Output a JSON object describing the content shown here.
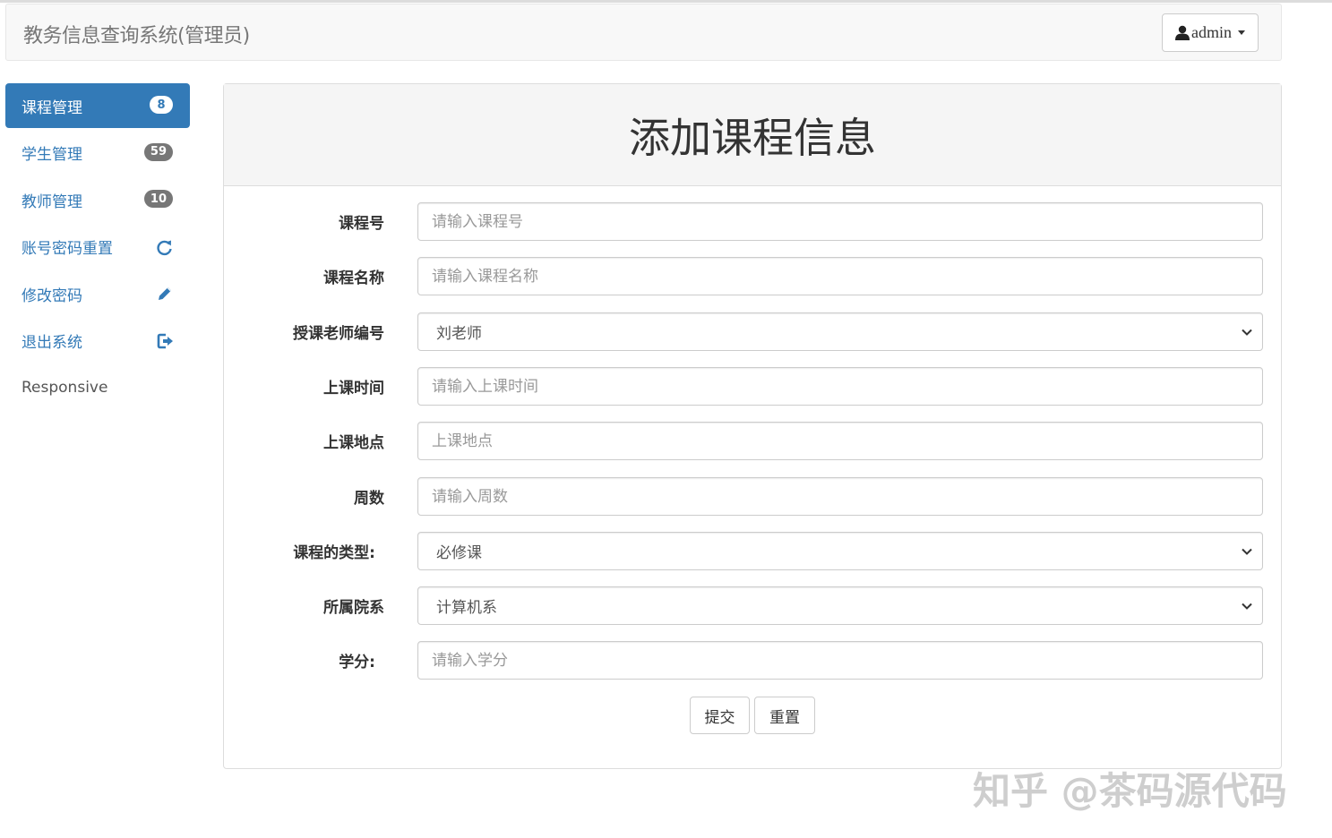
{
  "navbar": {
    "brand": "教务信息查询系统(管理员)",
    "user_label": "admin"
  },
  "sidebar": {
    "items": [
      {
        "label": "课程管理",
        "badge": "8"
      },
      {
        "label": "学生管理",
        "badge": "59"
      },
      {
        "label": "教师管理",
        "badge": "10"
      },
      {
        "label": "账号密码重置",
        "icon": "refresh-icon"
      },
      {
        "label": "修改密码",
        "icon": "pencil-icon"
      },
      {
        "label": "退出系统",
        "icon": "logout-icon"
      },
      {
        "label": "Responsive"
      }
    ]
  },
  "form": {
    "title": "添加课程信息",
    "fields": [
      {
        "label": "课程号",
        "placeholder": "请输入课程号"
      },
      {
        "label": "课程名称",
        "placeholder": "请输入课程名称"
      },
      {
        "label": "授课老师编号",
        "value": "刘老师"
      },
      {
        "label": "上课时间",
        "placeholder": "请输入上课时间"
      },
      {
        "label": "上课地点",
        "placeholder": "上课地点"
      },
      {
        "label": "周数",
        "placeholder": "请输入周数"
      },
      {
        "label": "课程的类型:",
        "value": "必修课"
      },
      {
        "label": "所属院系",
        "value": "计算机系"
      },
      {
        "label": "学分:",
        "placeholder": "请输入学分"
      }
    ],
    "submit_label": "提交",
    "reset_label": "重置"
  },
  "watermark": "知乎 @茶码源代码",
  "colors": {
    "accent": "#337ab7",
    "badge": "#777777",
    "panel_heading": "#f5f5f5"
  }
}
